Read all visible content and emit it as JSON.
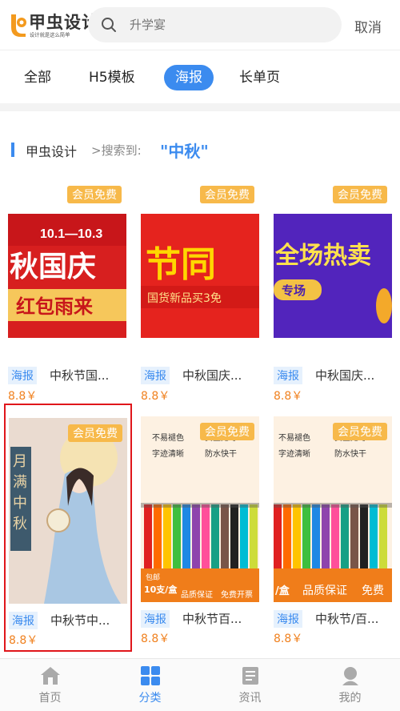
{
  "header": {
    "logo_text": "甲虫设计",
    "logo_sub": "设计就是这么简单",
    "search_placeholder": "升学宴",
    "cancel_label": "取消"
  },
  "tabs": [
    {
      "label": "全部",
      "active": false
    },
    {
      "label": "H5模板",
      "active": false
    },
    {
      "label": "海报",
      "active": true
    },
    {
      "label": "长单页",
      "active": false
    }
  ],
  "results": {
    "crumb": "甲虫设计",
    "separator": ">搜索到:",
    "query": "\"中秋\""
  },
  "cards": [
    {
      "badge": "会员免费",
      "tag": "海报",
      "title": "中秋节国...",
      "price": "8.8￥",
      "thumb_lines": [
        "10.1—10.3",
        "秋国庆",
        "红包雨来"
      ]
    },
    {
      "badge": "会员免费",
      "tag": "海报",
      "title": "中秋国庆...",
      "price": "8.8￥",
      "thumb_lines": [
        "节同",
        "国货新品买3免"
      ]
    },
    {
      "badge": "会员免费",
      "tag": "海报",
      "title": "中秋国庆...",
      "price": "8.8￥",
      "thumb_lines": [
        "全场热卖",
        "专场"
      ]
    },
    {
      "badge": "会员免费",
      "tag": "海报",
      "title": "中秋节中...",
      "price": "8.8￥",
      "thumb_lines": [
        "月满中秋"
      ]
    },
    {
      "badge": "会员免费",
      "tag": "海报",
      "title": "中秋节百...",
      "price": "8.8￥",
      "thumb_lines": [
        "不易褪色",
        "安全无毒",
        "字迹清晰",
        "防水快干",
        "包邮",
        "10支/盒",
        "品质保证",
        "免费开票"
      ]
    },
    {
      "badge": "会员免费",
      "tag": "海报",
      "title": "中秋节/百...",
      "price": "8.8￥",
      "thumb_lines": [
        "不易褪色",
        "安全无毒",
        "字迹清晰",
        "防水快干",
        "/盒",
        "品质保证",
        "免费"
      ]
    }
  ],
  "bottom_nav": [
    {
      "label": "首页",
      "icon": "home-icon",
      "active": false
    },
    {
      "label": "分类",
      "icon": "grid-icon",
      "active": true
    },
    {
      "label": "资讯",
      "icon": "news-icon",
      "active": false
    },
    {
      "label": "我的",
      "icon": "user-icon",
      "active": false
    }
  ],
  "colors": {
    "accent": "#3b8bef",
    "badge": "#f7b94a",
    "price": "#f0811f",
    "selected_border": "#e0161b"
  }
}
